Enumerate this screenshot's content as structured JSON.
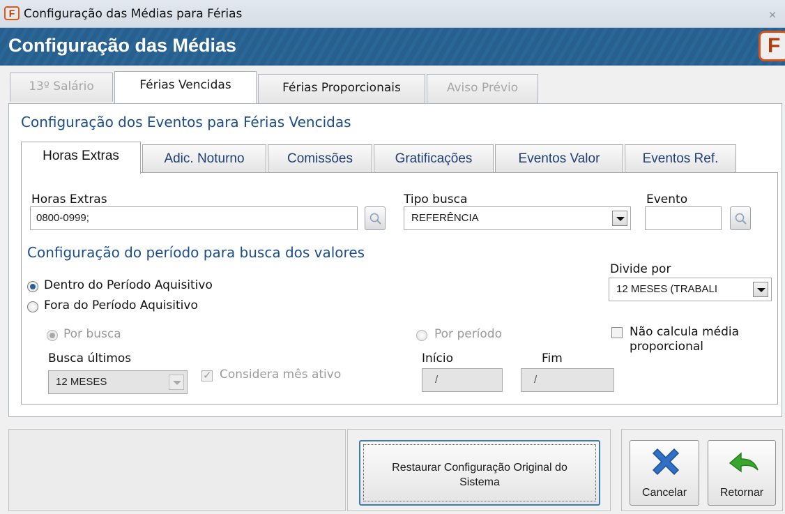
{
  "window": {
    "title": "Configuração das Médias para Férias",
    "close_label": "⨯"
  },
  "banner": {
    "title": "Configuração das Médias",
    "logo_letter": "F"
  },
  "tabs": [
    {
      "label": "13º Salário",
      "state": "disabled"
    },
    {
      "label": "Férias Vencidas",
      "state": "active"
    },
    {
      "label": "Férias Proporcionais",
      "state": "normal"
    },
    {
      "label": "Aviso Prévio",
      "state": "disabled"
    }
  ],
  "section": {
    "title": "Configuração dos Eventos para Férias Vencidas"
  },
  "inner_tabs": [
    {
      "label": "Horas Extras"
    },
    {
      "label": "Adic. Noturno"
    },
    {
      "label": "Comissões"
    },
    {
      "label": "Gratificações"
    },
    {
      "label": "Eventos Valor"
    },
    {
      "label": "Eventos Ref."
    }
  ],
  "form": {
    "horas_extras_label": "Horas Extras",
    "horas_extras_value": "0800-0999;",
    "tipo_busca_label": "Tipo busca",
    "tipo_busca_value": "REFERÊNCIA",
    "evento_label": "Evento",
    "evento_value": "",
    "periodo_title": "Configuração do período para busca dos valores",
    "divide_por_label": "Divide por",
    "divide_por_value": "12 MESES (TRABALI",
    "dentro_label": "Dentro do Período Aquisitivo",
    "fora_label": "Fora do Período Aquisitivo",
    "por_busca_label": "Por busca",
    "por_periodo_label": "Por período",
    "nao_calcula_label_1": "Não calcula média",
    "nao_calcula_label_2": "proporcional",
    "busca_ultimos_label": "Busca últimos",
    "busca_ultimos_value": "12 MESES",
    "considera_label": "Considera mês ativo",
    "inicio_label": "Início",
    "inicio_value": "/",
    "fim_label": "Fim",
    "fim_value": "/"
  },
  "buttons": {
    "restore_line1": "Restaurar Configuração Original do",
    "restore_line2": "Sistema",
    "cancel_label": "Cancelar",
    "return_label": "Retornar"
  },
  "colors": {
    "banner": "#27608f",
    "section_title": "#1b4d8a",
    "cancel_icon": "#2f6fc4",
    "return_icon": "#3aa52f"
  }
}
